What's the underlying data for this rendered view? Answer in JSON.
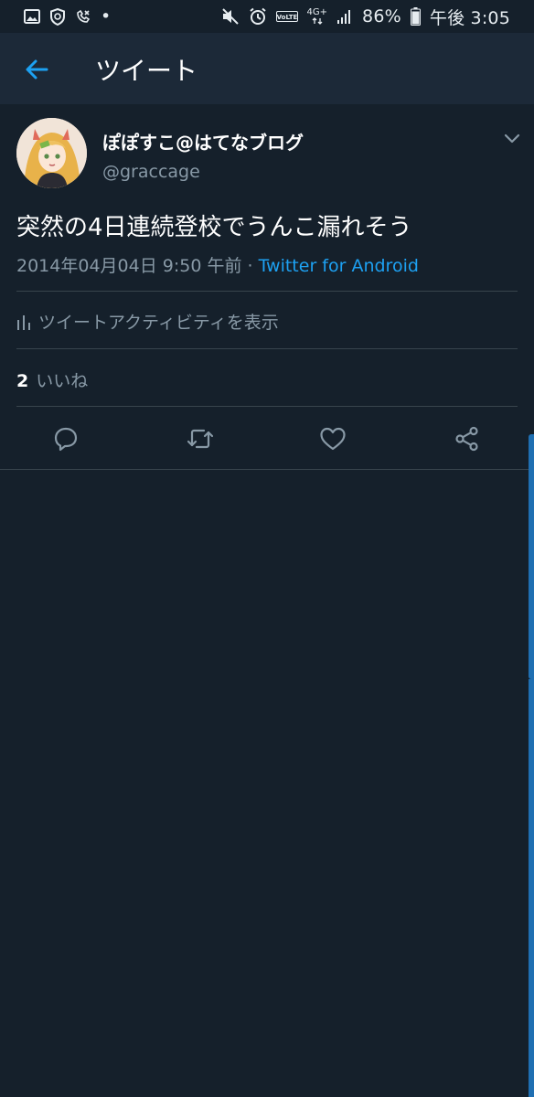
{
  "status_bar": {
    "dot": "•",
    "battery_percent": "86%",
    "time": "午後 3:05",
    "network": "4G+",
    "volte": "VoLTE",
    "icons_left": [
      "image-icon",
      "shield-icon",
      "missed-call-icon"
    ],
    "icons_right": [
      "mute-icon",
      "alarm-icon",
      "volte-icon",
      "network-4g-icon",
      "signal-icon",
      "battery-icon"
    ]
  },
  "appbar": {
    "title": "ツイート",
    "back_icon": "arrow-left-icon"
  },
  "tweet": {
    "display_name": "ぽぽすこ@はてなブログ",
    "handle": "@graccage",
    "text": "突然の4日連続登校でうんこ漏れそう",
    "date": "2014年04月04日 9:50 午前",
    "separator": " · ",
    "source": "Twitter for Android",
    "activity_label": "ツイートアクティビティを表示",
    "likes_count": "2",
    "likes_label": "いいね"
  },
  "actions": [
    {
      "name": "reply",
      "icon": "reply-icon"
    },
    {
      "name": "retweet",
      "icon": "retweet-icon"
    },
    {
      "name": "like",
      "icon": "heart-icon"
    },
    {
      "name": "share",
      "icon": "share-icon"
    }
  ],
  "colors": {
    "background": "#15202b",
    "appbar": "#1c2938",
    "accent": "#1da1f2",
    "secondary_text": "#8899a6",
    "divider": "#38444d"
  }
}
